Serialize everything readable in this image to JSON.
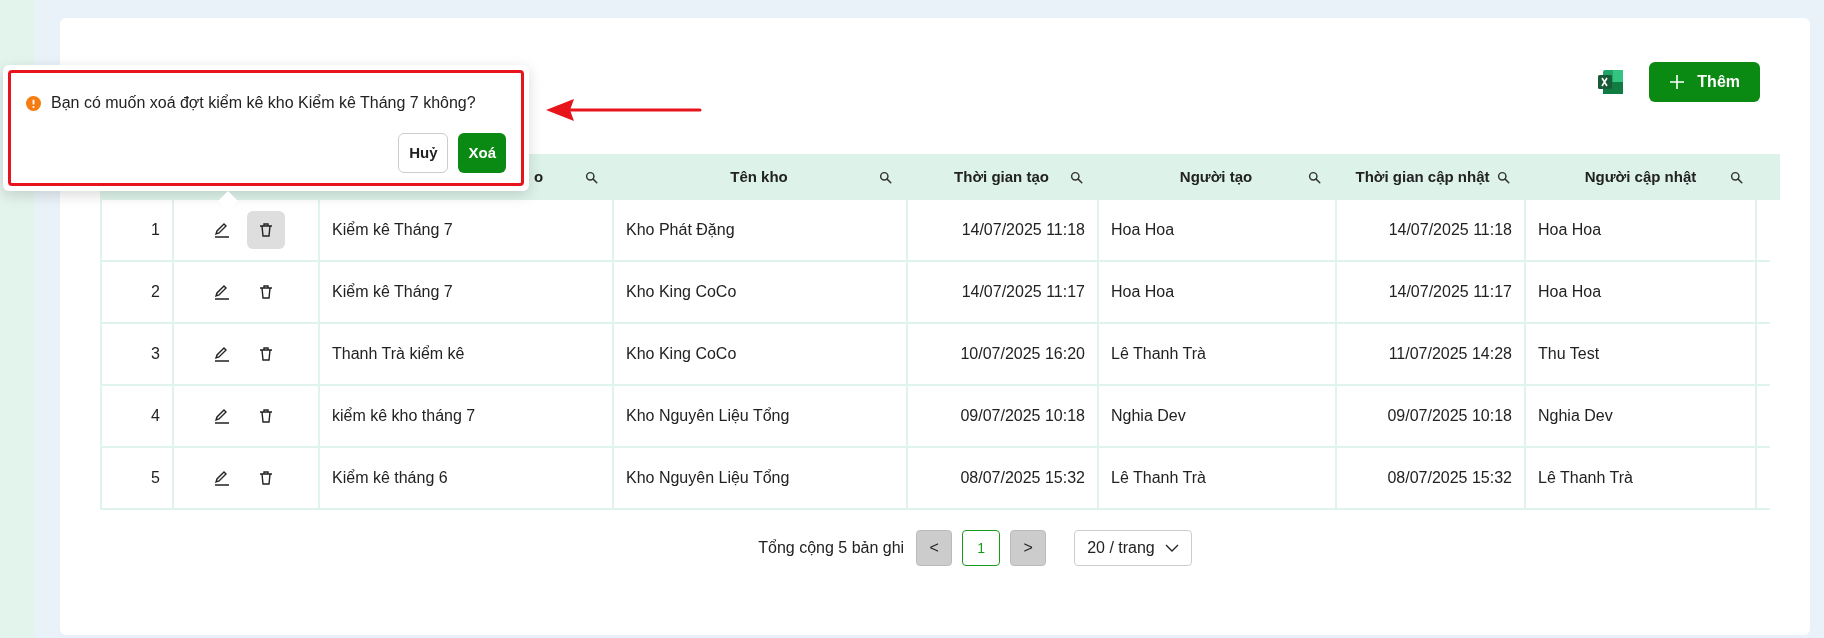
{
  "toolbar": {
    "add_button": "Thêm"
  },
  "table": {
    "columns": [
      {},
      {},
      {
        "label": "o"
      },
      {
        "label": "Tên kho"
      },
      {
        "label": "Thời gian tạo"
      },
      {
        "label": "Người tạo"
      },
      {
        "label": "Thời gian cập nhật"
      },
      {
        "label": "Người cập nhật"
      }
    ],
    "rows": [
      {
        "index": "1",
        "name": "Kiểm kê Tháng 7",
        "warehouse": "Kho Phát Đặng",
        "created": "14/07/2025 11:18",
        "creator": "Hoa Hoa",
        "updated": "14/07/2025 11:18",
        "updater": "Hoa Hoa",
        "delete_active": true
      },
      {
        "index": "2",
        "name": "Kiểm kê Tháng 7",
        "warehouse": "Kho King CoCo",
        "created": "14/07/2025 11:17",
        "creator": "Hoa Hoa",
        "updated": "14/07/2025 11:17",
        "updater": "Hoa Hoa",
        "delete_active": false
      },
      {
        "index": "3",
        "name": "Thanh Trà kiểm kê",
        "warehouse": "Kho King CoCo",
        "created": "10/07/2025 16:20",
        "creator": "Lê Thanh Trà",
        "updated": "11/07/2025 14:28",
        "updater": "Thu Test",
        "delete_active": false
      },
      {
        "index": "4",
        "name": "kiểm kê kho tháng 7",
        "warehouse": "Kho Nguyên Liệu Tổng",
        "created": "09/07/2025 10:18",
        "creator": "Nghia Dev",
        "updated": "09/07/2025 10:18",
        "updater": "Nghia Dev",
        "delete_active": false
      },
      {
        "index": "5",
        "name": "Kiểm kê tháng 6",
        "warehouse": "Kho Nguyên Liệu Tổng",
        "created": "08/07/2025 15:32",
        "creator": "Lê Thanh Trà",
        "updated": "08/07/2025 15:32",
        "updater": "Lê Thanh Trà",
        "delete_active": false
      }
    ]
  },
  "pagination": {
    "total": "Tổng cộng 5 bản ghi",
    "prev": "<",
    "pages": [
      {
        "label": "1",
        "selected": true
      }
    ],
    "next": ">",
    "page_size": "20 / trang"
  },
  "popconfirm": {
    "message": "Bạn có muốn xoá đợt kiểm kê kho Kiểm kê Tháng 7 không?",
    "cancel": "Huỷ",
    "confirm": "Xoá"
  }
}
